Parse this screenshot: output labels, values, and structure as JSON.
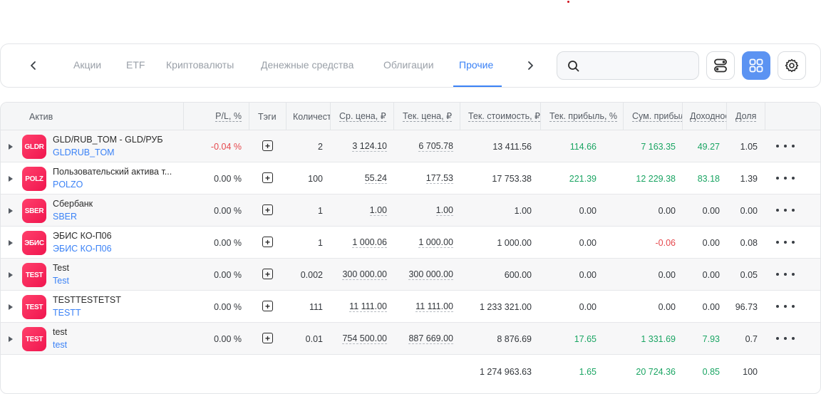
{
  "tabs": {
    "items": [
      {
        "label": "Акции",
        "active": false
      },
      {
        "label": "ETF",
        "active": false
      },
      {
        "label": "Криптовалюты",
        "active": false
      },
      {
        "label": "Денежные средства",
        "active": false
      },
      {
        "label": "Облигации",
        "active": false
      },
      {
        "label": "Прочие",
        "active": true
      }
    ]
  },
  "search": {
    "placeholder": "",
    "value": ""
  },
  "colors": {
    "accent": "#3b82f6",
    "positive": "#1aa563",
    "negative": "#e5484d",
    "logo": "#f0164f"
  },
  "table": {
    "headers": {
      "asset": "Актив",
      "pl": "P/L, %",
      "tags": "Тэги",
      "qty": "Количество",
      "avg_price": "Ср. цена, ₽",
      "cur_price": "Тек. цена, ₽",
      "cur_value": "Тек. стоимость, ₽",
      "cur_profit": "Тек. прибыль, %",
      "sum_profit": "Сум. прибыль",
      "yield": "Доходность",
      "share": "Доля"
    },
    "rows": [
      {
        "logo": "GLDR",
        "name": "GLD/RUB_TOM - GLD/РУБ",
        "ticker": "GLDRUB_TOM",
        "pl": "-0.04 %",
        "qty": "2",
        "avg_price": "3 124.10",
        "cur_price": "6 705.78",
        "cur_value": "13 411.56",
        "cur_profit": "114.66",
        "sum_profit": "7 163.35",
        "yield": "49.27",
        "share": "1.05"
      },
      {
        "logo": "POLZ",
        "name": "Пользовательский актива т...",
        "ticker": "POLZO",
        "pl": "0.00 %",
        "qty": "100",
        "avg_price": "55.24",
        "cur_price": "177.53",
        "cur_value": "17 753.38",
        "cur_profit": "221.39",
        "sum_profit": "12 229.38",
        "yield": "83.18",
        "share": "1.39"
      },
      {
        "logo": "SBER",
        "name": "Сбербанк",
        "ticker": "SBER",
        "pl": "0.00 %",
        "qty": "1",
        "avg_price": "1.00",
        "cur_price": "1.00",
        "cur_value": "1.00",
        "cur_profit": "0.00",
        "sum_profit": "0.00",
        "yield": "0.00",
        "share": "0.00"
      },
      {
        "logo": "ЭБИС",
        "name": "ЭБИС КО-П06",
        "ticker": "ЭБИС КО-П06",
        "pl": "0.00 %",
        "qty": "1",
        "avg_price": "1 000.06",
        "cur_price": "1 000.00",
        "cur_value": "1 000.00",
        "cur_profit": "0.00",
        "sum_profit": "-0.06",
        "yield": "0.00",
        "share": "0.08"
      },
      {
        "logo": "TEST",
        "name": "Test",
        "ticker": "Test",
        "pl": "0.00 %",
        "qty": "0.002",
        "avg_price": "300 000.00",
        "cur_price": "300 000.00",
        "cur_value": "600.00",
        "cur_profit": "0.00",
        "sum_profit": "0.00",
        "yield": "0.00",
        "share": "0.05"
      },
      {
        "logo": "TEST",
        "name": "TESTTESTETST",
        "ticker": "TESTT",
        "pl": "0.00 %",
        "qty": "111",
        "avg_price": "11 111.00",
        "cur_price": "11 111.00",
        "cur_value": "1 233 321.00",
        "cur_profit": "0.00",
        "sum_profit": "0.00",
        "yield": "0.00",
        "share": "96.73"
      },
      {
        "logo": "TEST",
        "name": "test",
        "ticker": "test",
        "pl": "0.00 %",
        "qty": "0.01",
        "avg_price": "754 500.00",
        "cur_price": "887 669.00",
        "cur_value": "8 876.69",
        "cur_profit": "17.65",
        "sum_profit": "1 331.69",
        "yield": "7.93",
        "share": "0.7"
      }
    ],
    "totals": {
      "cur_value": "1 274 963.63",
      "cur_profit": "1.65",
      "sum_profit": "20 724.36",
      "yield": "0.85",
      "share": "100"
    }
  }
}
